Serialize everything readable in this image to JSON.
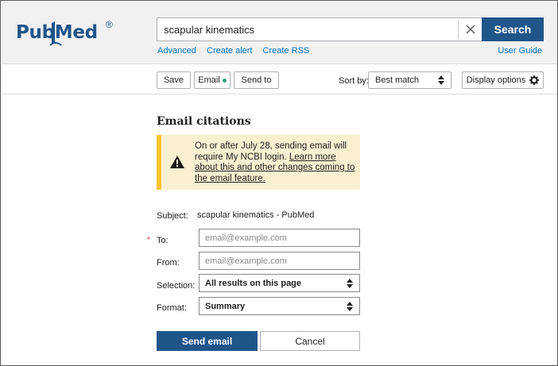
{
  "header": {
    "logo_text": "PubMed",
    "logo_reg": "®",
    "search_value": "scapular kinematics",
    "search_button": "Search",
    "links": [
      "Advanced",
      "Create alert",
      "Create RSS"
    ],
    "user_guide": "User Guide"
  },
  "toolbar": {
    "save": "Save",
    "email": "Email",
    "send_to": "Send to",
    "sort_label": "Sort by:",
    "sort_value": "Best match",
    "display_options": "Display options"
  },
  "email_form": {
    "title": "Email citations",
    "notice": {
      "text": "On or after July 28, sending email will require My NCBI login. ",
      "link": "Learn more about this and other changes coming to the email feature."
    },
    "subject_label": "Subject:",
    "subject_value": "scapular kinematics - PubMed",
    "required_mark": "*",
    "to_label": "To:",
    "to_placeholder": "email@example.com",
    "from_label": "From:",
    "from_placeholder": "email@example.com",
    "selection_label": "Selection:",
    "selection_value": "All results on this page",
    "format_label": "Format:",
    "format_value": "Summary",
    "send_button": "Send email",
    "cancel_button": "Cancel"
  },
  "colors": {
    "brand": "#20558a",
    "link": "#0071bc",
    "notice_bg": "#faf0d1",
    "notice_border": "#fcc230",
    "email_dot": "#2e9c7a",
    "required": "#d83933"
  },
  "icons": {
    "clear": "close-icon",
    "sort_arrows": "sort-arrows-icon",
    "settings": "gear-icon",
    "warning": "warning-icon",
    "logo_book": "book-icon"
  }
}
